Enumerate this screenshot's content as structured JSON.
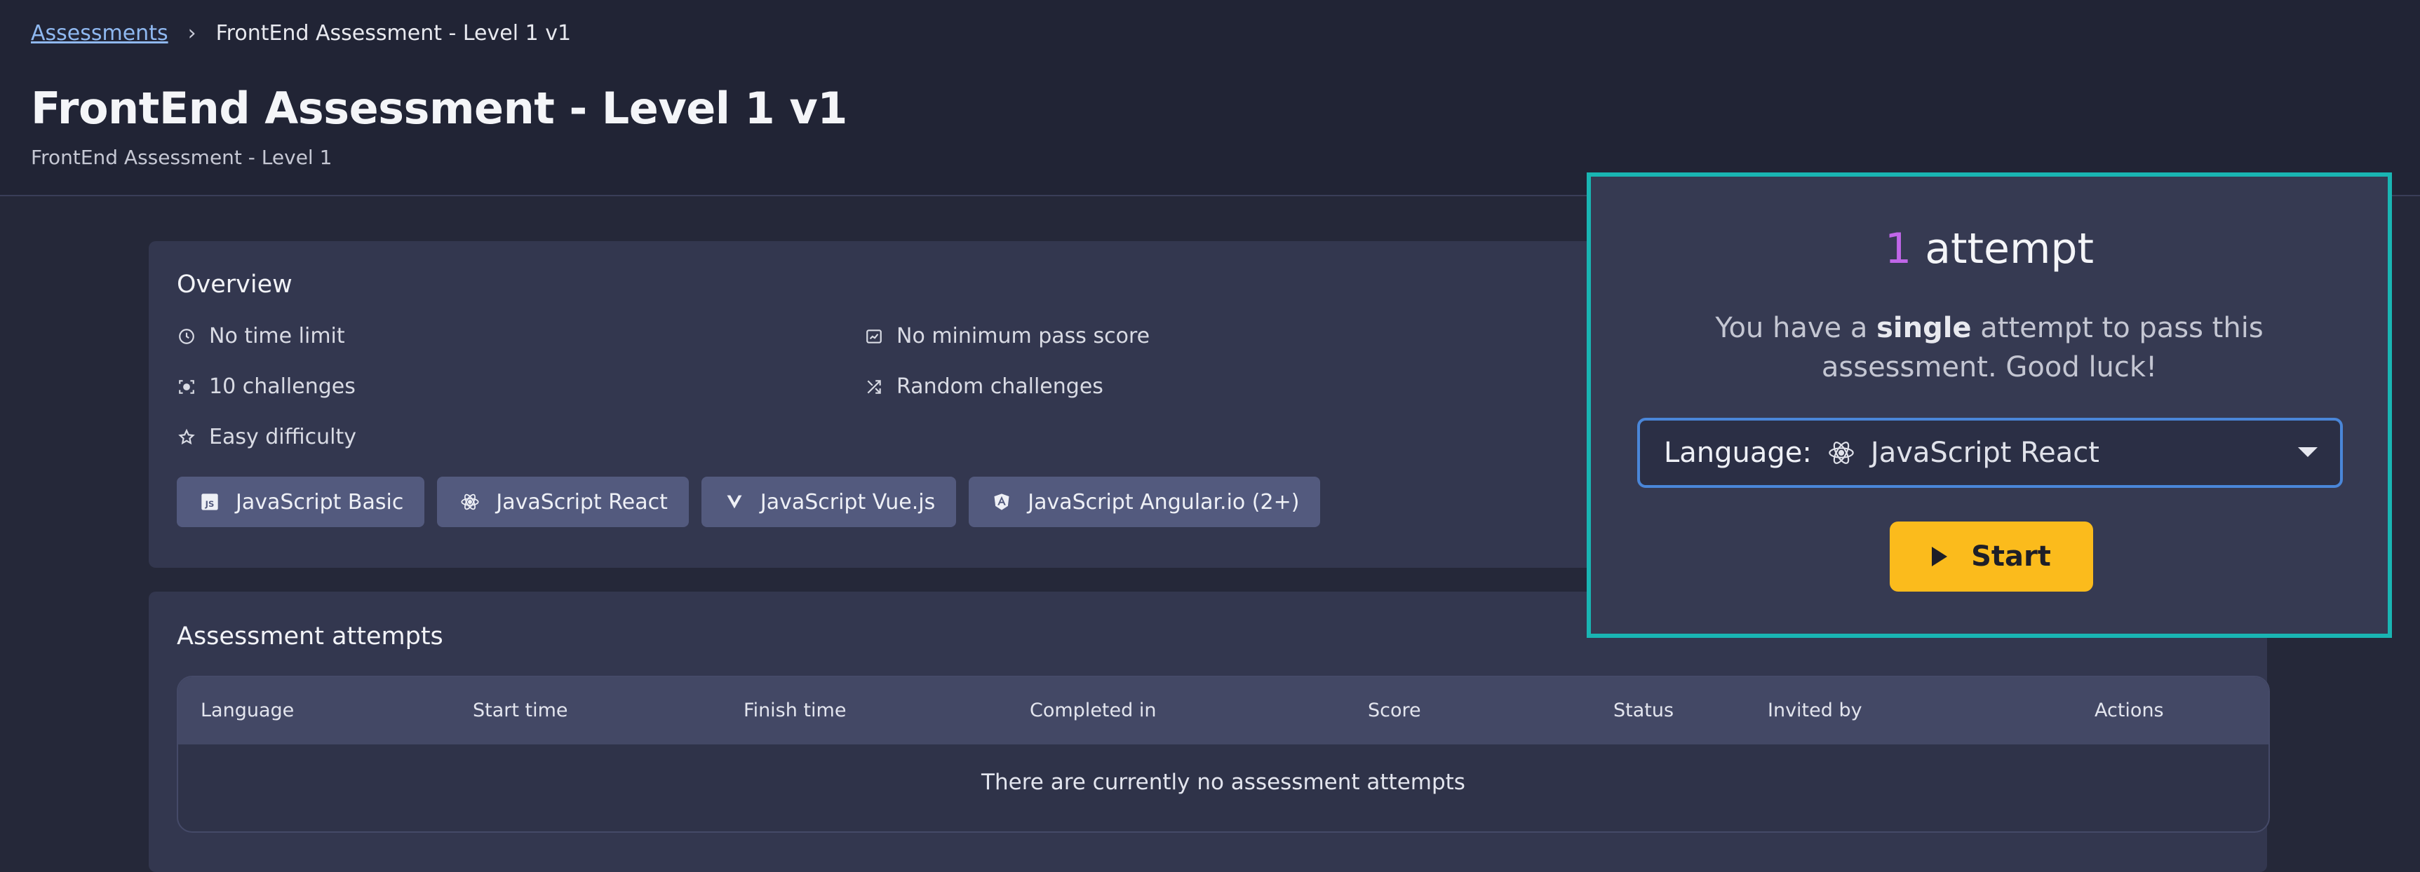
{
  "breadcrumb": {
    "root": "Assessments",
    "separator": "›",
    "current": "FrontEnd Assessment - Level 1 v1"
  },
  "page": {
    "title": "FrontEnd Assessment - Level 1 v1",
    "subtitle": "FrontEnd Assessment - Level 1"
  },
  "overview": {
    "title": "Overview",
    "features": {
      "time": {
        "icon": "clock-icon",
        "label": "No time limit"
      },
      "score": {
        "icon": "score-icon",
        "label": "No minimum pass score"
      },
      "challenges": {
        "icon": "target-icon",
        "label": "10 challenges"
      },
      "random": {
        "icon": "shuffle-icon",
        "label": "Random challenges"
      },
      "difficulty": {
        "icon": "star-icon",
        "label": "Easy difficulty"
      }
    },
    "languages": [
      {
        "icon": "javascript-icon",
        "label": "JavaScript Basic"
      },
      {
        "icon": "react-icon",
        "label": "JavaScript React"
      },
      {
        "icon": "vue-icon",
        "label": "JavaScript Vue.js"
      },
      {
        "icon": "angular-icon",
        "label": "JavaScript Angular.io (2+)"
      }
    ]
  },
  "attempts": {
    "title": "Assessment attempts",
    "columns": [
      "Language",
      "Start time",
      "Finish time",
      "Completed in",
      "Score",
      "Status",
      "Invited by",
      "Actions"
    ],
    "empty_message": "There are currently no assessment attempts"
  },
  "popup": {
    "attempt_count": "1",
    "attempt_word": "attempt",
    "message_prefix": "You have a ",
    "message_bold": "single",
    "message_suffix": " attempt to pass this assessment. Good luck!",
    "language_label": "Language:",
    "language_icon": "react-icon",
    "language_value": "JavaScript React",
    "start_label": "Start",
    "accent_color": "#19b5b3",
    "start_color": "#fbbb1c"
  }
}
